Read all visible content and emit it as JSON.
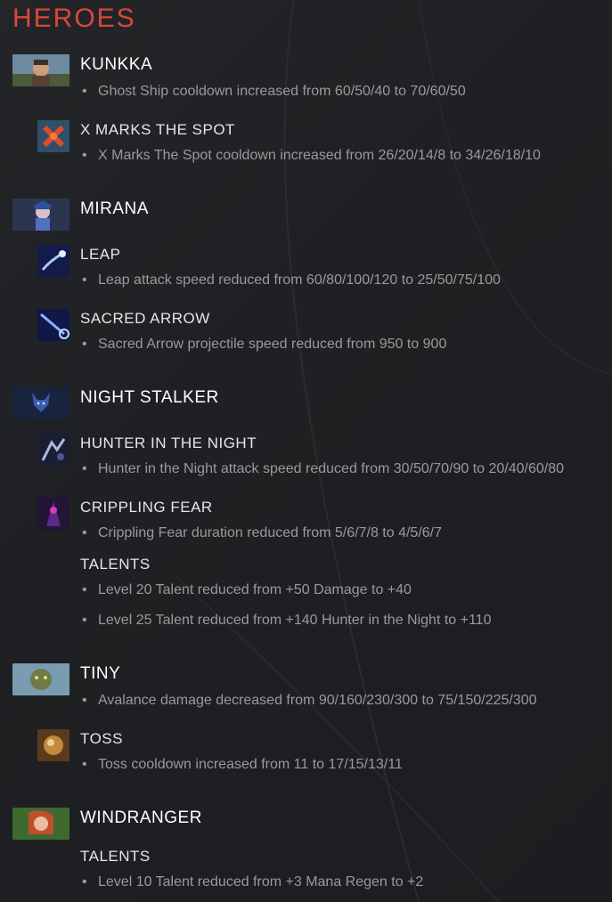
{
  "page": {
    "title": "HEROES"
  },
  "colors": {
    "title": "#d8483a",
    "heading": "#ffffff",
    "note": "#9a9a9a",
    "background": "#1e2023"
  },
  "bullet": "•",
  "heroes": [
    {
      "name": "KUNKKA",
      "icon": "kunkka-portrait-icon",
      "abilities": [
        {
          "name": "",
          "notes": [
            "Ghost Ship cooldown increased from 60/50/40 to 70/60/50"
          ]
        },
        {
          "name": "X MARKS THE SPOT",
          "icon": "x-marks-the-spot-icon",
          "notes": [
            "X Marks The Spot cooldown increased from 26/20/14/8 to 34/26/18/10"
          ]
        }
      ]
    },
    {
      "name": "MIRANA",
      "icon": "mirana-portrait-icon",
      "abilities": [
        {
          "name": "LEAP",
          "icon": "leap-icon",
          "notes": [
            "Leap attack speed reduced from 60/80/100/120 to 25/50/75/100"
          ]
        },
        {
          "name": "SACRED ARROW",
          "icon": "sacred-arrow-icon",
          "notes": [
            "Sacred Arrow projectile speed reduced from 950 to 900"
          ]
        }
      ]
    },
    {
      "name": "NIGHT STALKER",
      "icon": "night-stalker-portrait-icon",
      "abilities": [
        {
          "name": "HUNTER IN THE NIGHT",
          "icon": "hunter-in-the-night-icon",
          "notes": [
            "Hunter in the Night attack speed reduced from 30/50/70/90 to 20/40/60/80"
          ]
        },
        {
          "name": "CRIPPLING FEAR",
          "icon": "crippling-fear-icon",
          "notes": [
            "Crippling Fear duration reduced from 5/6/7/8 to 4/5/6/7"
          ]
        },
        {
          "name": "TALENTS",
          "notes": [
            "Level 20 Talent reduced from +50 Damage to +40",
            "Level 25 Talent reduced from +140 Hunter in the Night to +110"
          ]
        }
      ]
    },
    {
      "name": "TINY",
      "icon": "tiny-portrait-icon",
      "abilities": [
        {
          "name": "",
          "notes": [
            "Avalance damage decreased from 90/160/230/300 to 75/150/225/300"
          ]
        },
        {
          "name": "TOSS",
          "icon": "toss-icon",
          "notes": [
            "Toss cooldown increased from 11 to 17/15/13/11"
          ]
        }
      ]
    },
    {
      "name": "WINDRANGER",
      "icon": "windranger-portrait-icon",
      "abilities": [
        {
          "name": "TALENTS",
          "notes": [
            "Level 10 Talent reduced from +3 Mana Regen to +2"
          ]
        }
      ]
    }
  ]
}
